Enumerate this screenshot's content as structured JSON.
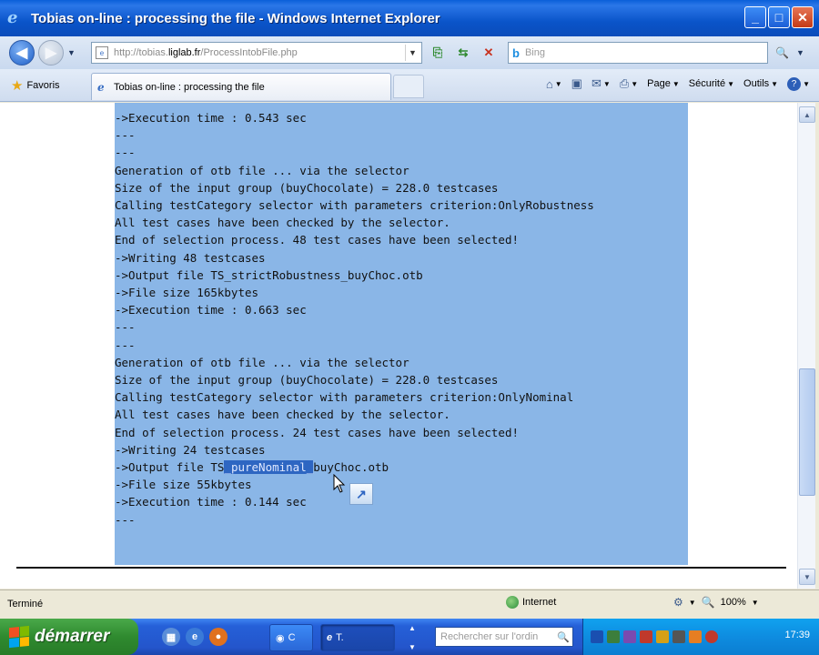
{
  "window": {
    "title": "Tobias on-line : processing the file - Windows Internet Explorer",
    "minimize_glyph": "_",
    "maximize_glyph": "□",
    "close_glyph": "✕"
  },
  "nav": {
    "url_prefix": "http://tobias.",
    "url_domain": "liglab.fr",
    "url_path": "/ProcessIntobFile.php",
    "search_placeholder": "Bing"
  },
  "tabs": {
    "favorites_label": "Favoris",
    "active_tab_label": "Tobias on-line : processing the file"
  },
  "commands": {
    "page_label": "Page",
    "security_label": "Sécurité",
    "tools_label": "Outils"
  },
  "output_lines": [
    "->Execution time : 0.543 sec",
    "---",
    "---",
    "Generation of otb file ... via the selector",
    "Size of the input group (buyChocolate) = 228.0 testcases",
    "Calling testCategory selector with parameters criterion:OnlyRobustness",
    "All test cases have been checked by the selector.",
    "End of selection process. 48 test cases have been selected!",
    "->Writing 48 testcases",
    "->Output file TS_strictRobustness_buyChoc.otb",
    "->File size 165kbytes",
    "->Execution time : 0.663 sec",
    "---",
    "---",
    "Generation of otb file ... via the selector",
    "Size of the input group (buyChocolate) = 228.0 testcases",
    "Calling testCategory selector with parameters criterion:OnlyNominal",
    "All test cases have been checked by the selector.",
    "End of selection process. 24 test cases have been selected!",
    "->Writing 24 testcases"
  ],
  "output_highlight_line": {
    "before": "->Output file TS",
    "highlighted": "_pureNominal_",
    "after": "buyChoc.otb"
  },
  "output_tail_lines": [
    "->File size 55kbytes",
    "->Execution time : 0.144 sec",
    "---"
  ],
  "status": {
    "text": "Terminé",
    "zone": "Internet",
    "zoom": "100%"
  },
  "taskbar": {
    "start_label": "démarrer",
    "task1_label": "C",
    "task2_label": "T.",
    "search_placeholder": "Rechercher sur l'ordin",
    "clock": "17:39"
  },
  "colors": {
    "selection": "#8ab6e7",
    "highlight": "#2e66c2",
    "titlebar": "#0a54c9"
  }
}
